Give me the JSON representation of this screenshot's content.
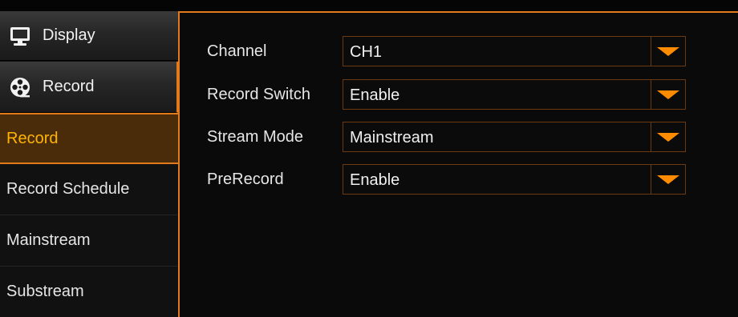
{
  "sidebar": {
    "categories": [
      {
        "label": "Display",
        "icon": "monitor-icon"
      },
      {
        "label": "Record",
        "icon": "film-reel-icon"
      }
    ],
    "items": [
      {
        "label": "Record",
        "active": true
      },
      {
        "label": "Record Schedule",
        "active": false
      },
      {
        "label": "Mainstream",
        "active": false
      },
      {
        "label": "Substream",
        "active": false
      }
    ]
  },
  "settings": [
    {
      "label": "Channel",
      "value": "CH1"
    },
    {
      "label": "Record Switch",
      "value": "Enable"
    },
    {
      "label": "Stream Mode",
      "value": "Mainstream"
    },
    {
      "label": "PreRecord",
      "value": "Enable"
    }
  ],
  "colors": {
    "accent": "#e07a1a",
    "active_text": "#ffb400",
    "active_bg": "#4a2c0a",
    "dropdown_arrow": "#ff8c00"
  }
}
